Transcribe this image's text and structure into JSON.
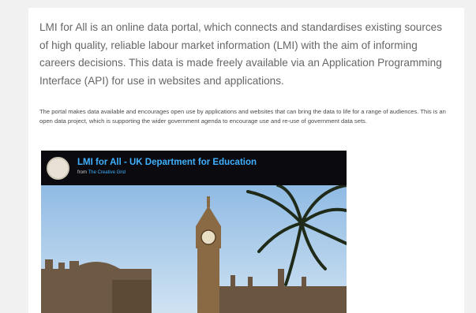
{
  "intro_text": "LMI for All is an online data portal, which connects and standardises existing sources of high quality, reliable labour market information (LMI) with the aim of informing careers decisions. This data is made freely available via an Application Programming Interface (API) for use in websites and applications.",
  "small_text": "The portal makes data available and encourages open use by applications and websites that can bring the data to life for a range of audiences. This is an open data project, which is supporting the wider government agenda to encourage use and re-use of government data sets.",
  "video": {
    "title": "LMI for All - UK Department for Education",
    "from_label": "from",
    "channel_name": "The Creative Grid"
  }
}
